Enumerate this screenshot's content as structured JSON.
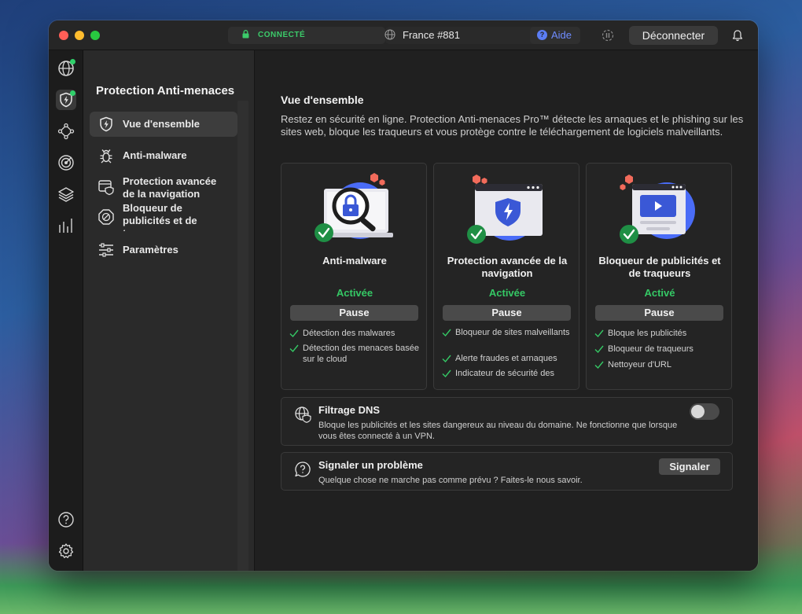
{
  "titlebar": {
    "status": "CONNECTÉ",
    "server": "France #881",
    "help": "Aide",
    "disconnect": "Déconnecter"
  },
  "colors": {
    "accent_blue": "#4a6cf7",
    "status_green": "#35c865",
    "danger_red": "#f26b5b"
  },
  "rail": {
    "items": [
      "globe-icon",
      "shield-bolt-icon",
      "mesh-network-icon",
      "target-icon",
      "layers-icon",
      "bar-chart-icon",
      "help-icon",
      "settings-icon"
    ]
  },
  "sidebar": {
    "title": "Protection Anti-menaces",
    "items": [
      {
        "label": "Vue d'ensemble",
        "icon": "shield-bolt-icon"
      },
      {
        "label": "Anti-malware",
        "icon": "bug-icon"
      },
      {
        "label": "Protection avancée de la navigation",
        "icon": "browser-shield-icon"
      },
      {
        "label": "Bloqueur de publicités et de traqueurs",
        "icon": "block-icon"
      },
      {
        "label": "Paramètres",
        "icon": "sliders-icon"
      }
    ]
  },
  "main": {
    "title": "Vue d'ensemble",
    "description": "Restez en sécurité en ligne. Protection Anti-menaces Pro™ détecte les arnaques et le phishing sur les sites web, bloque les traqueurs et vous protège contre le téléchargement de logiciels malveillants.",
    "cards": [
      {
        "title": "Anti-malware",
        "status": "Activée",
        "pause": "Pause",
        "features": [
          "Détection des malwares",
          "Détection des menaces basée sur le cloud"
        ]
      },
      {
        "title": "Protection avancée de la navigation",
        "status": "Activée",
        "pause": "Pause",
        "features": [
          "Bloqueur de sites malveillants",
          "Alerte fraudes et arnaques",
          "Indicateur de sécurité des"
        ]
      },
      {
        "title": "Bloqueur de publicités et de traqueurs",
        "status": "Activé",
        "pause": "Pause",
        "features": [
          "Bloque les publicités",
          "Bloqueur de traqueurs",
          "Nettoyeur d'URL"
        ]
      }
    ],
    "dns": {
      "title": "Filtrage DNS",
      "description": "Bloque les publicités et les sites dangereux au niveau du domaine. Ne fonctionne que lorsque vous êtes connecté à un VPN.",
      "enabled": false
    },
    "report": {
      "title": "Signaler un problème",
      "description": "Quelque chose ne marche pas comme prévu ? Faites-le nous savoir.",
      "button": "Signaler"
    }
  }
}
